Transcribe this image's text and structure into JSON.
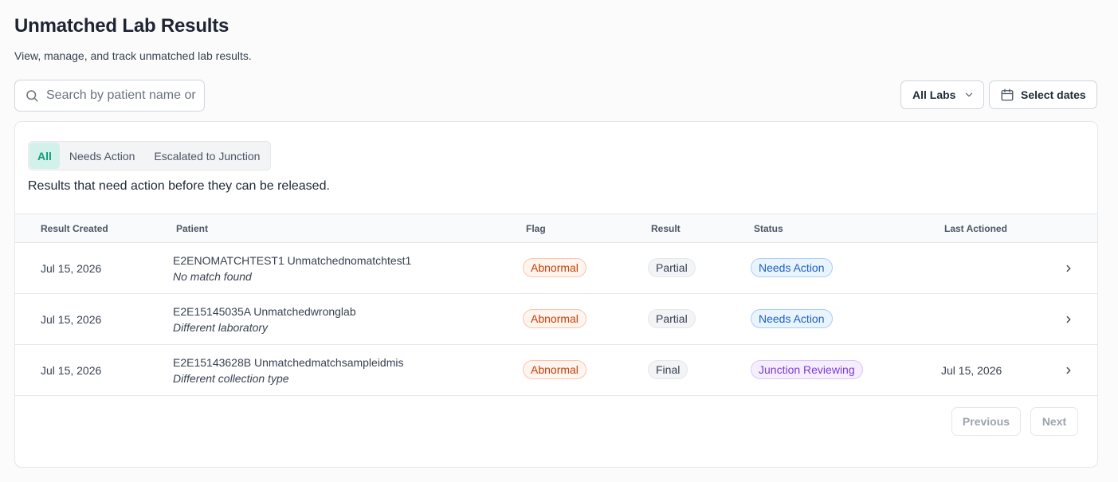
{
  "header": {
    "title": "Unmatched Lab Results",
    "subtitle": "View, manage, and track unmatched lab results."
  },
  "search": {
    "placeholder": "Search by patient name or ID",
    "value": "",
    "icon": "search-icon"
  },
  "filters": {
    "labs_label": "All Labs",
    "labs_icon": "chevron-down-icon",
    "dates_label": "Select dates",
    "dates_icon": "calendar-icon"
  },
  "tabs": [
    {
      "label": "All",
      "active": true
    },
    {
      "label": "Needs Action",
      "active": false
    },
    {
      "label": "Escalated to Junction",
      "active": false
    }
  ],
  "tab_description": "Results that need action before they can be released.",
  "table": {
    "columns": [
      "Result Created",
      "Patient",
      "Flag",
      "Result",
      "Status",
      "Last Actioned"
    ],
    "rows": [
      {
        "created": "Jul 15, 2026",
        "patient_name": "E2ENOMATCHTEST1 Unmatchednomatchtest1",
        "patient_reason": "No match found",
        "flag": "Abnormal",
        "result": "Partial",
        "status": "Needs Action",
        "last_actioned": ""
      },
      {
        "created": "Jul 15, 2026",
        "patient_name": "E2E15145035A Unmatchedwronglab",
        "patient_reason": "Different laboratory",
        "flag": "Abnormal",
        "result": "Partial",
        "status": "Needs Action",
        "last_actioned": ""
      },
      {
        "created": "Jul 15, 2026",
        "patient_name": "E2E15143628B Unmatchedmatchsampleidmis",
        "patient_reason": "Different collection type",
        "flag": "Abnormal",
        "result": "Final",
        "status": "Junction Reviewing",
        "last_actioned": "Jul 15, 2026"
      }
    ]
  },
  "pagination": {
    "previous_label": "Previous",
    "next_label": "Next"
  },
  "colors": {
    "accent": "#0f9b7a",
    "flag_abnormal": "#c2410c",
    "status_needs_action": "#1d5fc2",
    "status_reviewing": "#7e3bd1"
  }
}
